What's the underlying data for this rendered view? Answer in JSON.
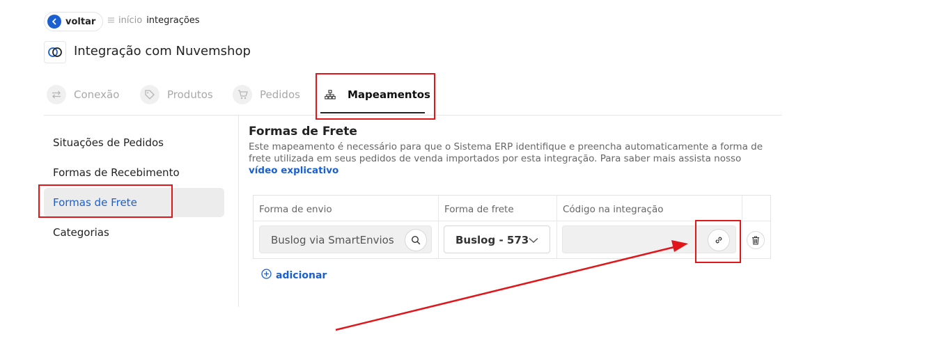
{
  "header": {
    "back_label": "voltar",
    "breadcrumb": [
      "início",
      "integrações"
    ],
    "page_title": "Integração com Nuvemshop"
  },
  "tabs": [
    {
      "label": "Conexão",
      "icon": "arrows-swap-icon",
      "active": false
    },
    {
      "label": "Produtos",
      "icon": "tag-icon",
      "active": false
    },
    {
      "label": "Pedidos",
      "icon": "cart-icon",
      "active": false
    },
    {
      "label": "Mapeamentos",
      "icon": "sitemap-icon",
      "active": true
    }
  ],
  "sidebar": {
    "items": [
      {
        "label": "Situações de Pedidos",
        "active": false
      },
      {
        "label": "Formas de Recebimento",
        "active": false
      },
      {
        "label": "Formas de Frete",
        "active": true
      },
      {
        "label": "Categorias",
        "active": false
      }
    ]
  },
  "main": {
    "title": "Formas de Frete",
    "description": "Este mapeamento é necessário para que o Sistema ERP identifique e preencha automaticamente a forma de frete utilizada em seus pedidos de venda importados por esta integração. Para saber mais assista nosso",
    "description_link": "vídeo explicativo",
    "table": {
      "headers": [
        "Forma de envio",
        "Forma de frete",
        "Código na integração"
      ],
      "rows": [
        {
          "forma_envio": "Buslog via SmartEnvios",
          "forma_frete": "Buslog - 573",
          "codigo": ""
        }
      ]
    },
    "add_label": "adicionar"
  },
  "colors": {
    "accent": "#1b5fd1",
    "annotation": "#e0161b"
  }
}
